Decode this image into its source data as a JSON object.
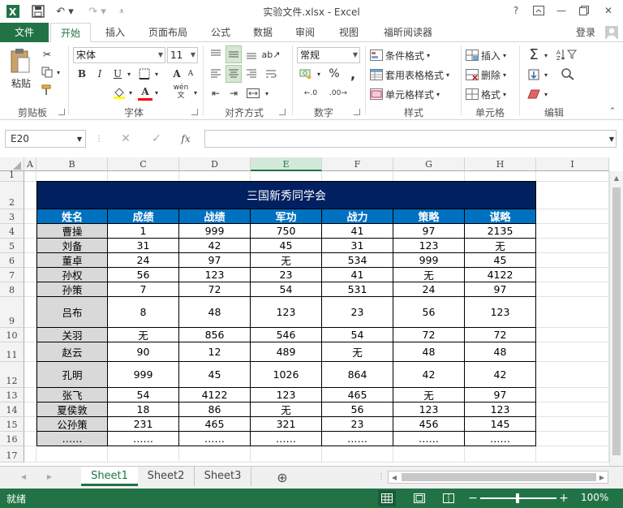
{
  "app": {
    "title": "实验文件.xlsx - Excel",
    "login": "登录",
    "help": "?"
  },
  "tabs": [
    "文件",
    "开始",
    "插入",
    "页面布局",
    "公式",
    "数据",
    "审阅",
    "视图",
    "福昕阅读器"
  ],
  "ribbon": {
    "clipboard": {
      "label": "剪贴板",
      "paste": "粘贴"
    },
    "font": {
      "label": "字体",
      "name": "宋体",
      "size": "11",
      "bold": "B",
      "italic": "I",
      "underline": "U",
      "grow": "A",
      "wen": "wén"
    },
    "alignment": {
      "label": "对齐方式"
    },
    "number": {
      "label": "数字",
      "format": "常规",
      "percent": "%",
      "comma": ",",
      "inc": ".0",
      "dec": ".00"
    },
    "styles": {
      "label": "样式",
      "conditional": "条件格式",
      "table": "套用表格格式",
      "cell": "单元格样式"
    },
    "cells": {
      "label": "单元格",
      "insert": "插入",
      "delete": "删除",
      "format": "格式"
    },
    "editing": {
      "label": "编辑",
      "sum": "Σ"
    }
  },
  "formula_bar": {
    "name_box": "E20",
    "fx": "fx",
    "value": ""
  },
  "columns": [
    "A",
    "B",
    "C",
    "D",
    "E",
    "F",
    "G",
    "H",
    "I"
  ],
  "rows": [
    "1",
    "2",
    "3",
    "4",
    "5",
    "6",
    "7",
    "8",
    "9",
    "10",
    "11",
    "12",
    "13",
    "14",
    "15",
    "16",
    "17"
  ],
  "table": {
    "title": "三国新秀同学会",
    "headers": [
      "姓名",
      "成绩",
      "战绩",
      "军功",
      "战力",
      "策略",
      "谋略"
    ],
    "data": [
      [
        "曹操",
        "1",
        "999",
        "750",
        "41",
        "97",
        "2135"
      ],
      [
        "刘备",
        "31",
        "42",
        "45",
        "31",
        "123",
        "无"
      ],
      [
        "董卓",
        "24",
        "97",
        "无",
        "534",
        "999",
        "45"
      ],
      [
        "孙权",
        "56",
        "123",
        "23",
        "41",
        "无",
        "4122"
      ],
      [
        "孙策",
        "7",
        "72",
        "54",
        "531",
        "24",
        "97"
      ],
      [
        "吕布",
        "8",
        "48",
        "123",
        "23",
        "56",
        "123"
      ],
      [
        "关羽",
        "无",
        "856",
        "546",
        "54",
        "72",
        "72"
      ],
      [
        "赵云",
        "90",
        "12",
        "489",
        "无",
        "48",
        "48"
      ],
      [
        "孔明",
        "999",
        "45",
        "1026",
        "864",
        "42",
        "42"
      ],
      [
        "张飞",
        "54",
        "4122",
        "123",
        "465",
        "无",
        "97"
      ],
      [
        "夏侯敦",
        "18",
        "86",
        "无",
        "56",
        "123",
        "123"
      ],
      [
        "公孙策",
        "231",
        "465",
        "321",
        "23",
        "456",
        "145"
      ],
      [
        "……",
        "……",
        "……",
        "……",
        "……",
        "……",
        "……"
      ]
    ]
  },
  "sheets": [
    "Sheet1",
    "Sheet2",
    "Sheet3"
  ],
  "status": {
    "ready": "就绪",
    "zoom": "100%",
    "plus": "+"
  },
  "colors": {
    "excel_green": "#217346",
    "title_navy": "#002060",
    "header_blue": "#0070c0",
    "name_gray": "#d9d9d9"
  }
}
